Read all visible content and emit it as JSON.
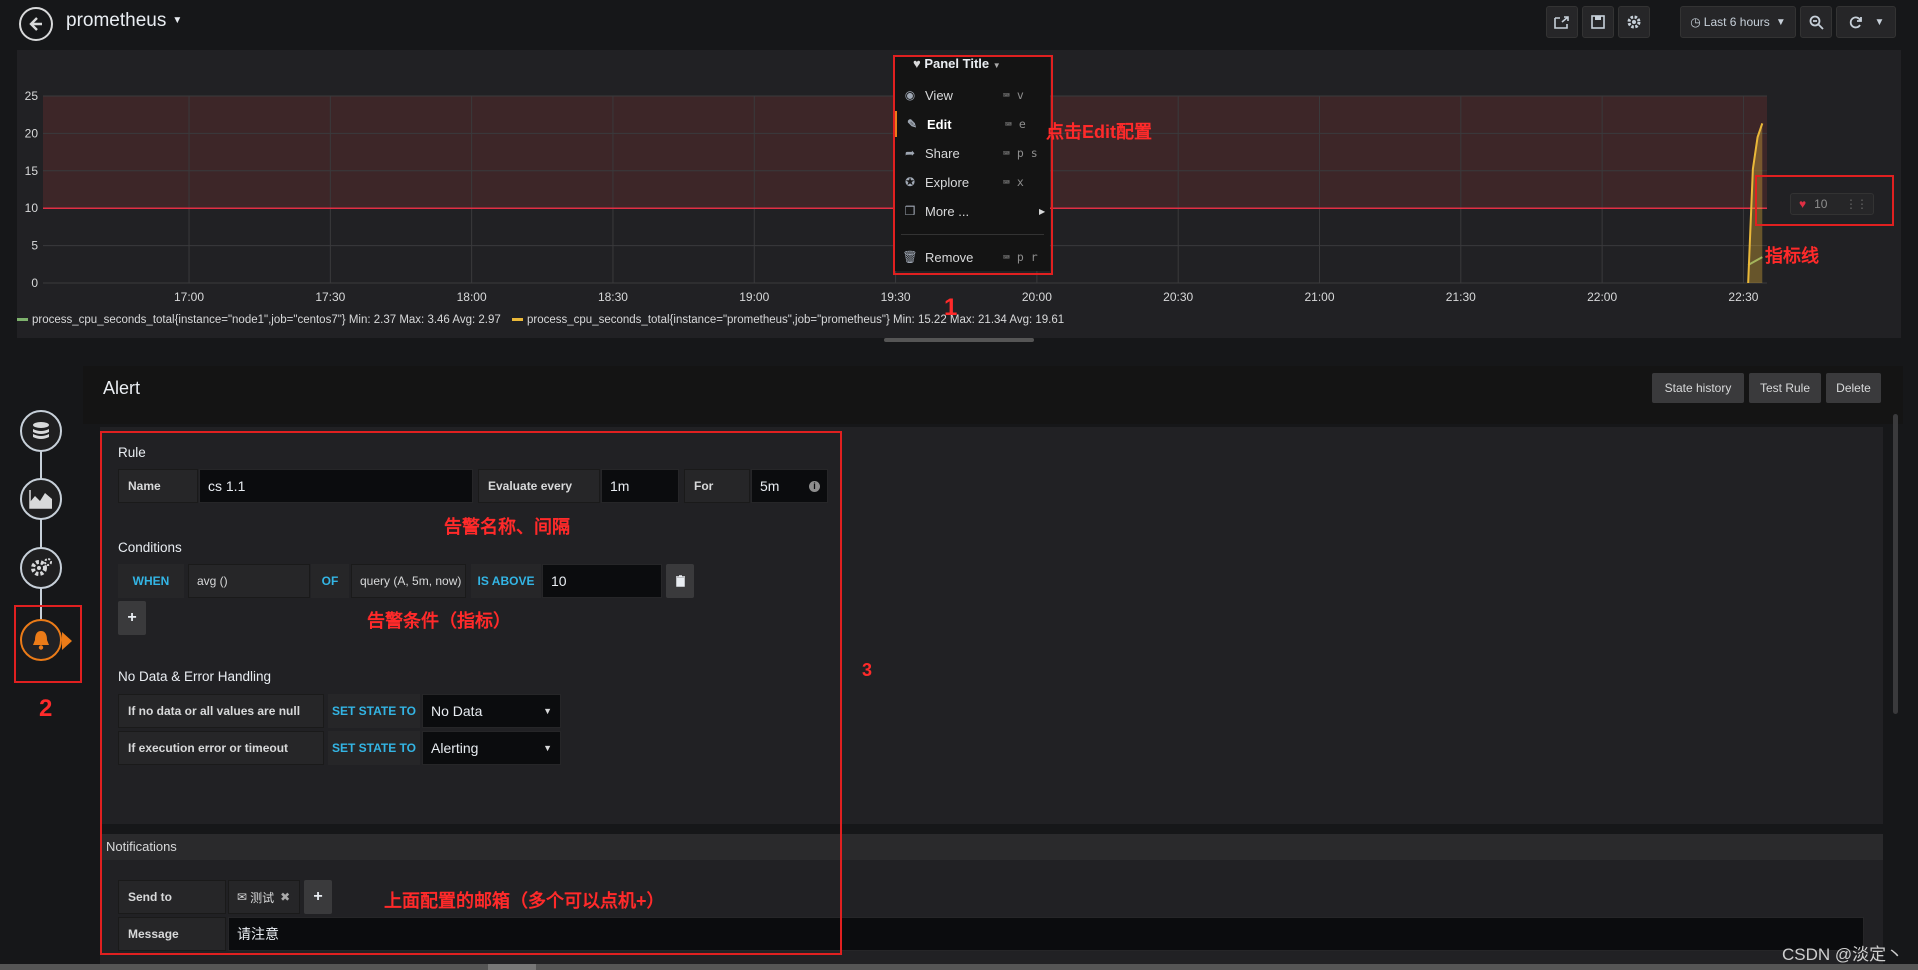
{
  "topbar": {
    "dashboard_title": "prometheus",
    "time_range": "Last 6 hours"
  },
  "panel": {
    "menu_title": "Panel Title",
    "menu_items": [
      {
        "label": "View",
        "shortcut": "v"
      },
      {
        "label": "Edit",
        "shortcut": "e"
      },
      {
        "label": "Share",
        "shortcut": "p s"
      },
      {
        "label": "Explore",
        "shortcut": "x"
      },
      {
        "label": "More ...",
        "shortcut": ""
      },
      {
        "label": "Remove",
        "shortcut": "p r"
      }
    ],
    "threshold_value": "10",
    "legend": [
      {
        "text": "process_cpu_seconds_total{instance=\"node1\",job=\"centos7\"}  Min: 2.37  Max: 3.46  Avg: 2.97",
        "color": "#7eb26d"
      },
      {
        "text": "process_cpu_seconds_total{instance=\"prometheus\",job=\"prometheus\"}  Min: 15.22  Max: 21.34  Avg: 19.61",
        "color": "#eab839"
      }
    ]
  },
  "chart_data": {
    "type": "line",
    "x_ticks": [
      "17:00",
      "17:30",
      "18:00",
      "18:30",
      "19:00",
      "19:30",
      "20:00",
      "20:30",
      "21:00",
      "21:30",
      "22:00",
      "22:30"
    ],
    "y_ticks": [
      0,
      5,
      10,
      15,
      20,
      25
    ],
    "ylim": [
      0,
      25
    ],
    "threshold": 10,
    "series": [
      {
        "name": "process_cpu_seconds_total{instance=\"node1\",job=\"centos7\"}",
        "color": "#7eb26d",
        "points": [
          [
            "22:31",
            2.4
          ],
          [
            "22:34",
            3.46
          ]
        ]
      },
      {
        "name": "process_cpu_seconds_total{instance=\"prometheus\",job=\"prometheus\"}",
        "color": "#eab839",
        "points": [
          [
            "22:31",
            0
          ],
          [
            "22:32",
            15.22
          ],
          [
            "22:33",
            19.5
          ],
          [
            "22:34",
            21.34
          ]
        ]
      }
    ]
  },
  "alert": {
    "title": "Alert",
    "buttons": {
      "state_history": "State history",
      "test_rule": "Test Rule",
      "delete": "Delete"
    },
    "rule": {
      "section": "Rule",
      "name_label": "Name",
      "name_value": "cs 1.1",
      "eval_label": "Evaluate every",
      "eval_value": "1m",
      "for_label": "For",
      "for_value": "5m"
    },
    "conditions": {
      "section": "Conditions",
      "when": "WHEN",
      "reducer": "avg ()",
      "of": "OF",
      "query": "query (A, 5m, now)",
      "evaluator": "IS ABOVE",
      "threshold": "10"
    },
    "nodata": {
      "section": "No Data & Error Handling",
      "row1_label": "If no data or all values are null",
      "row1_kw": "SET STATE TO",
      "row1_value": "No Data",
      "row2_label": "If execution error or timeout",
      "row2_kw": "SET STATE TO",
      "row2_value": "Alerting"
    },
    "notifications": {
      "section": "Notifications",
      "send_to_label": "Send to",
      "channel": "测试",
      "message_label": "Message",
      "message_value": "请注意"
    }
  },
  "annotations": {
    "edit_note": "点击Edit配置",
    "threshold_note": "指标线",
    "name_note": "告警名称、间隔",
    "cond_note": "告警条件（指标）",
    "mail_note": "上面配置的邮箱（多个可以点机+）",
    "num1": "1",
    "num2": "2",
    "num3": "3"
  },
  "watermark": "CSDN @淡定丶"
}
